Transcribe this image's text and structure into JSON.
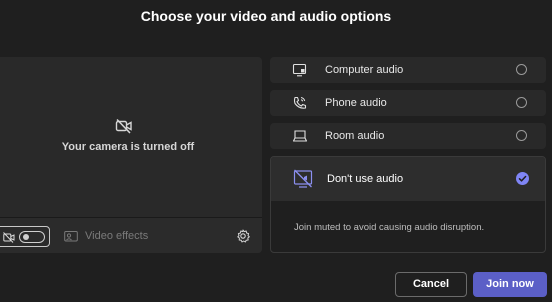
{
  "dialog": {
    "title": "Choose your video and audio options"
  },
  "video": {
    "camera_status": "Your camera is turned off",
    "camera_toggle": {
      "state": "off"
    },
    "effects_label": "Video effects"
  },
  "audio": {
    "options": [
      {
        "label": "Computer audio",
        "icon": "computer-icon",
        "selected": false
      },
      {
        "label": "Phone audio",
        "icon": "phone-icon",
        "selected": false
      },
      {
        "label": "Room audio",
        "icon": "room-device-icon",
        "selected": false
      },
      {
        "label": "Don't use audio",
        "icon": "no-audio-icon",
        "selected": true,
        "description": "Join muted to avoid causing audio disruption."
      }
    ]
  },
  "footer": {
    "cancel_label": "Cancel",
    "join_label": "Join now"
  },
  "colors": {
    "accent": "#5b5fc7",
    "selected_check": "#7f85f5",
    "background": "#1f1f1f",
    "panel": "#292929"
  }
}
